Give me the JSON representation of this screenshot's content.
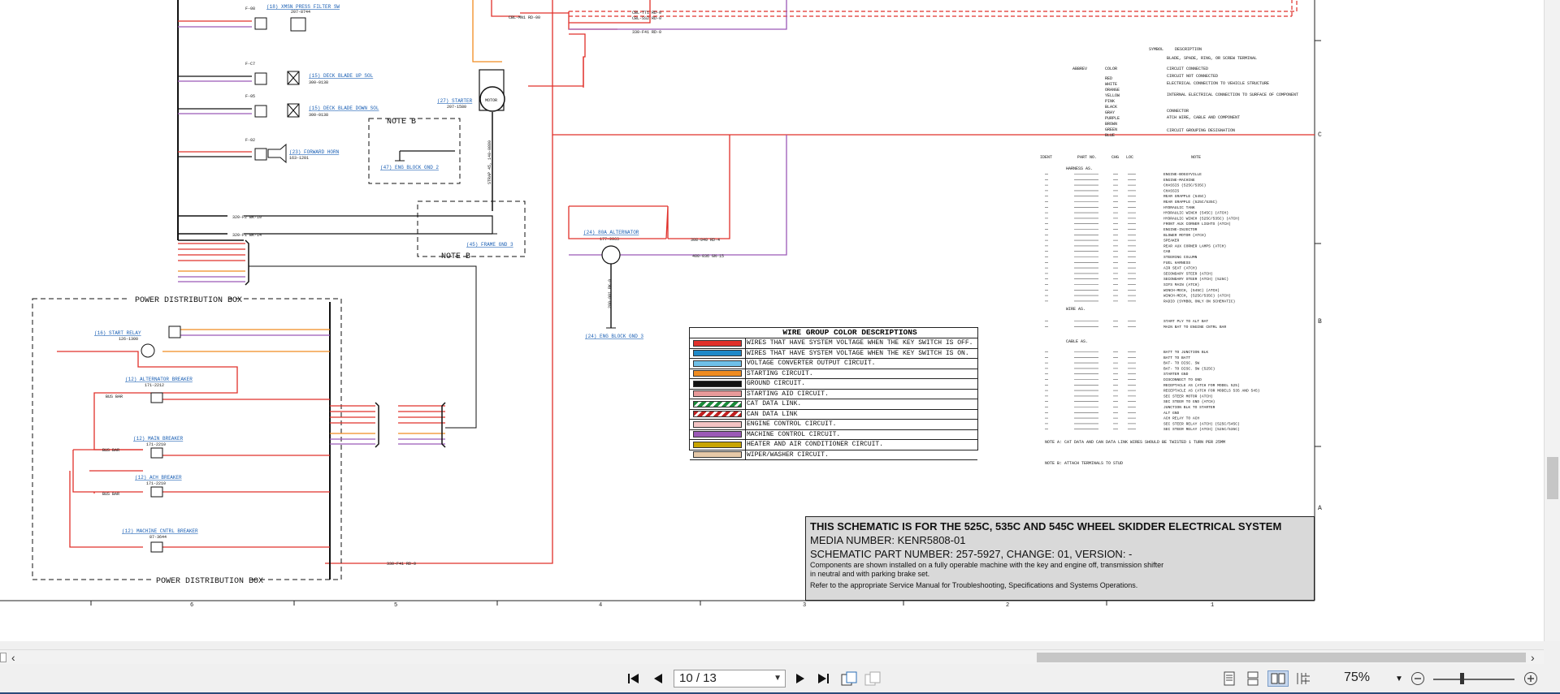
{
  "schematic": {
    "top_labels": {
      "xmsn_filter": "(18) XMSN PRESS FILTER SW",
      "xmsn_filter_pn": "207-8744",
      "deck_up": "(15) DECK BLADE UP SOL",
      "deck_up_pn": "300-0138",
      "deck_down": "(15) DECK BLADE DOWN SOL",
      "deck_down_pn": "300-0138",
      "horn": "(23) FORWARD HORN",
      "horn_pn": "163-1201",
      "starter": "(27) STARTER",
      "starter_pn": "207-1580",
      "motor": "MOTOR",
      "note_b1": "NOTE B",
      "note_b2": "NOTE B",
      "eng_block": "(47) ENG BLOCK GND 2",
      "frame_gnd": "(45) FRAME GND 3",
      "alternator": "(24) 80A ALTERNATOR",
      "alternator_pn": "177-9963",
      "eng_block3": "(24) ENG BLOCK GND 3",
      "fuse1": "F-08",
      "fuse2": "F-C7",
      "fuse3": "F-05",
      "fuse4": "F-02",
      "wire_a": "CBL-MN1  RD-00",
      "wire_b": "CBL-TT1  RD-0",
      "wire_c": "CBL-SS2  RD-0",
      "wire_d": "330-F41  RD-0",
      "wire_e": "308-040  RD-4",
      "wire_f": "400-036  GN-15",
      "wire_g": "320-F1  BK-14",
      "wire_h": "320-F2  BK-10",
      "strap": "STRAP 45, 140-0880",
      "alt_wire": "200-001  BK-0"
    },
    "power_box": {
      "title_top": "POWER DISTRIBUTION BOX",
      "title_bottom": "POWER DISTRIBUTION BOX",
      "start_relay": "(16) START RELAY",
      "start_relay_pn": "126-1300",
      "alt_breaker": "(12) ALTERNATOR BREAKER",
      "alt_breaker_pn": "171-2212",
      "main_breaker": "(12) MAIN BREAKER",
      "main_breaker_pn": "171-2210",
      "ach_breaker": "(12) ACH BREAKER",
      "ach_breaker_pn": "171-2210",
      "mach_breaker": "(12) MACHINE CNTRL BREAKER",
      "mach_breaker_pn": "87-3644",
      "bus_bar": "BUS BAR"
    },
    "wire_group": {
      "title": "WIRE GROUP COLOR DESCRIPTIONS",
      "rows": [
        {
          "color": "#e0302a",
          "pattern": "solid",
          "label": "WIRES THAT HAVE SYSTEM VOLTAGE WHEN THE KEY SWITCH IS OFF."
        },
        {
          "color": "#1e88c8",
          "pattern": "solid",
          "label": "WIRES THAT HAVE SYSTEM VOLTAGE WHEN THE KEY SWITCH IS ON."
        },
        {
          "color": "#6fc0e8",
          "pattern": "solid",
          "label": "VOLTAGE CONVERTER OUTPUT CIRCUIT."
        },
        {
          "color": "#f08c20",
          "pattern": "solid",
          "label": "STARTING CIRCUIT."
        },
        {
          "color": "#111111",
          "pattern": "solid",
          "label": "GROUND CIRCUIT."
        },
        {
          "color": "#e89a9a",
          "pattern": "solid",
          "label": "STARTING AID CIRCUIT."
        },
        {
          "color": "#1a8a3a",
          "pattern": "stripe",
          "label": "CAT DATA LINK."
        },
        {
          "color": "#c02020",
          "pattern": "stripe",
          "label": "CAN DATA LINK"
        },
        {
          "color": "#f4c4c4",
          "pattern": "solid",
          "label": "ENGINE CONTROL CIRCUIT."
        },
        {
          "color": "#9b59b6",
          "pattern": "solid",
          "label": "MACHINE CONTROL CIRCUIT."
        },
        {
          "color": "#c8a400",
          "pattern": "solid",
          "label": "HEATER AND AIR CONDITIONER CIRCUIT."
        },
        {
          "color": "#e6c9a8",
          "pattern": "solid",
          "label": "WIPER/WASHER CIRCUIT."
        }
      ]
    },
    "title_block": {
      "line1": "THIS SCHEMATIC IS FOR THE 525C, 535C AND 545C WHEEL SKIDDER ELECTRICAL SYSTEM",
      "line2": "MEDIA NUMBER: KENR5808-01",
      "line3": "SCHEMATIC PART NUMBER: 257-5927, CHANGE: 01, VERSION: -",
      "line4": "Components are shown installed on a fully operable machine with the key and engine off, transmission shifter",
      "line5": "in neutral and with parking brake set.",
      "line6": "Refer to the appropriate Service Manual for Troubleshooting, Specifications and Systems Operations."
    },
    "legend": {
      "abbrev_hdr": "ABBREV",
      "color_hdr": "COLOR",
      "symbol_hdr": "SYMBOL",
      "desc_hdr": "DESCRIPTION",
      "colors": [
        "RED",
        "WHITE",
        "ORANGE",
        "YELLOW",
        "PINK",
        "BLACK",
        "GRAY",
        "PURPLE",
        "BROWN",
        "GREEN",
        "BLUE"
      ],
      "symbols": [
        "BLADE, SPADE, RING, OR SCREW TERMINAL",
        "CIRCUIT CONNECTED",
        "CIRCUIT NOT CONNECTED",
        "ELECTRICAL CONNECTION TO VEHICLE STRUCTURE",
        "INTERNAL ELECTRICAL CONNECTION TO SURFACE OF COMPONENT",
        "CONNECTOR",
        "ATCH WIRE, CABLE AND COMPONENT",
        "CIRCUIT GROUPING DESIGNATION"
      ]
    },
    "harness_table": {
      "headers": [
        "IDENT",
        "PART NO.",
        "CHG",
        "LOC",
        "NOTE"
      ],
      "section1": "HARNESS AS.",
      "notes": [
        "ENGINE-BOGGYVILLE",
        "ENGINE-MACHINE",
        "CHASSIS (525C/535C)",
        "CHASSIS",
        "REAR GRAPPLE (545C)",
        "REAR GRAPPLE (525C/535C)",
        "HYDRAULIC TANK",
        "HYDRAULIC WINCH (545C) (ATCH)",
        "HYDRAULIC WINCH (525C/535C) (ATCH)",
        "FRONT AUX CORNER LIGHTS (ATCH)",
        "ENGINE-INJECTOR",
        "BLOWER MOTOR (ATCH)",
        "SPEAKER",
        "REAR AUX CORNER LAMPS (ATCH)",
        "CAB",
        "STEERING COLUMN",
        "FUEL HARNESS",
        "AIR SEAT (ATCH)",
        "SECONDARY STEER (ATCH)",
        "SECONDARY STEER (ATCH) (525C)",
        "SIFS MAIN (ATCH)",
        "WINCH-MECH, (545C) (ATCH)",
        "WINCH-MECH, (525C/535C) (ATCH)",
        "RADIO (SYMBOL ONLY ON SCHEMATIC)"
      ],
      "section2": "WIRE AS.",
      "wire_notes": [
        "START PLY TO ALT BAT",
        "MAIN BAT TO ENGINE CNTRL BAR"
      ],
      "section3": "CABLE AS.",
      "cable_notes": [
        "BATT TO JUNCTION BLK",
        "BATT TO BATT",
        "BAT- TO DISC. SW",
        "BAT- TO DISC. SW (525C)",
        "STARTER GND",
        "DISCONNECT TO GND",
        "RECEPTACLE AS (ATCH FOR MODEL 525)",
        "RECEPTACLE AS (ATCH FOR MODELS 535 AND 545)",
        "SEC STEER MOTOR (ATCH)",
        "SEC STEER TO GND (ATCH)",
        "JUNCTION BLK TO STARTER",
        "ALT GND",
        "ACH RELAY TO ACH",
        "SEC STEER RELAY (ATCH) (525C/545C)",
        "SEC STEER RELAY (ATCH) (525C/535C)"
      ],
      "note_a": "NOTE A:  CAT DATA AND CAN DATA LINK WIRES SHOULD BE TWISTED 1 TURN PER 25MM",
      "note_b": "NOTE B:  ATTACH TERMINALS TO STUD"
    },
    "grid_bottom": [
      "6",
      "5",
      "4",
      "3",
      "2",
      "1"
    ],
    "grid_right": [
      "C",
      "B",
      "A"
    ]
  },
  "viewer": {
    "page_value": "10 / 13",
    "zoom": "75%",
    "icons": [
      "first-page-icon",
      "prev-page-icon",
      "next-page-icon",
      "last-page-icon",
      "extract-page-icon",
      "insert-page-icon",
      "single-page-icon",
      "continuous-icon",
      "two-page-icon",
      "two-page-continuous-icon",
      "zoom-out-icon",
      "zoom-in-icon",
      "zoom-dropdown-icon"
    ]
  }
}
